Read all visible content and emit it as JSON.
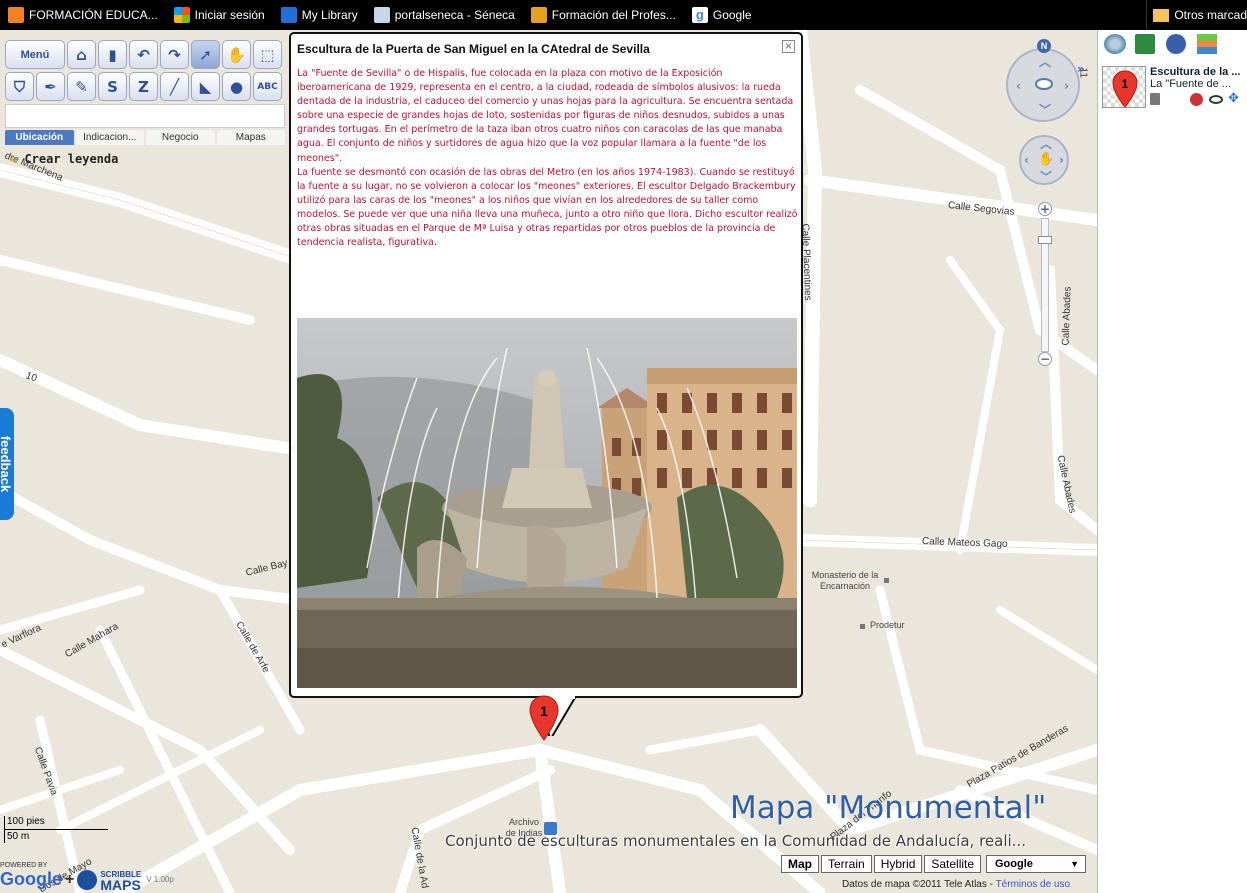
{
  "bookmarks": [
    {
      "label": "FORMACIÓN EDUCA...",
      "icon": "formacion-icon",
      "color": "#f58220"
    },
    {
      "label": "Iniciar sesión",
      "icon": "windows-icon",
      "color": "#2a8ad4"
    },
    {
      "label": "My Library",
      "icon": "library-icon",
      "color": "#1e6fd9"
    },
    {
      "label": "portalseneca - Séneca",
      "icon": "page-icon",
      "color": "#c9d6e8"
    },
    {
      "label": "Formación del Profes...",
      "icon": "formacion-profes-icon",
      "color": "#e8a020"
    },
    {
      "label": "Google",
      "icon": "google-icon",
      "color": "#4285f4"
    }
  ],
  "bookmarks_right": {
    "label": "Otros marcad",
    "icon": "folder-icon"
  },
  "toolbar": {
    "menu_label": "Menú",
    "tabs": [
      "Ubicación",
      "Indicacion...",
      "Negocio",
      "Mapas"
    ],
    "legend_label": "Crear leyenda"
  },
  "feedback_label": "feedback",
  "streets": [
    "dre Marchena",
    "Calle Placentines",
    "Calle Segovias",
    "Calle Abades",
    "Calle Abades",
    "Calle Mateos Gago",
    "Calle Bay",
    "e Varflora",
    "Calle Mahara",
    "Calle de Arfe",
    "Calle Pavia",
    "Calle de la Ad",
    "Plaza del Triunfo",
    "Plaza Patios de Banderas",
    "Dos de Mayo",
    "10",
    "11"
  ],
  "pois": {
    "monasterio": "Monasterio de la Encarnación",
    "prodetur": "Prodetur",
    "archivo": "Archivo de Indias"
  },
  "popup": {
    "title": "Escultura de la Puerta de San Miguel en la CAtedral de Sevilla",
    "close": "×",
    "paragraph1": "La \"Fuente de Sevilla\" o de Hispalis, fue colocada en la plaza con motivo de la Exposición iberoamericana de 1929, representa en el centro, a la ciudad, rodeada de símbolos alusivos: la rueda dentada de la industria, el caduceo del comercio y unas hojas para la agricultura. Se encuentra sentada sobre una especie de grandes hojas de loto, sostenidas por figuras de niños desnudos, subidos a unas grandes tortugas. En el perímetro de la taza iban otros cuatro niños con caracolas de las que manaba agua. El conjunto de niños y surtidores de agua hizo que la voz popular llamara a la fuente \"de los meones\".",
    "paragraph2": "La fuente se desmontó con ocasión de las obras del Metro (en los años 1974-1983). Cuando se restituyó la fuente a su lugar, no se volvieron a colocar los \"meones\" exteriores. El escultor Delgado Brackembury utilizó para las caras de los \"meones\" a los niños que vivían en los alrededores de su taller como modelos. Se puede ver que una niña lleva una muñeca, junto a otro niño que llora. Dicho escultor realizó otras obras situadas en el Parque de Mª Luisa y otras repartidas por otros pueblos de la provincia de tendencia realista, figurativa."
  },
  "marker_number": "1",
  "nav": {
    "north": "N",
    "zoom_in": "+",
    "zoom_out": "−"
  },
  "map_title": "Mapa \"Monumental\"",
  "map_subtitle": "Conjunto de esculturas monumentales en la Comunidad de Andalucía, reali...",
  "map_types": [
    "Map",
    "Terrain",
    "Hybrid",
    "Satellite"
  ],
  "map_type_selected": "Map",
  "provider": "Google",
  "copyright": {
    "text": "Datos de mapa ©2011 Tele Atlas - ",
    "link": "Términos de uso"
  },
  "scale": {
    "ft": "100 pies",
    "m": "50 m"
  },
  "powered": {
    "label": "POWERED BY",
    "google": "Google",
    "plus": "+",
    "scribble": "SCRIBBLE",
    "maps": "MAPS",
    "version": "V 1.00p"
  },
  "panel": {
    "layer_title": "Escultura de la ...",
    "layer_desc": "La \"Fuente de ...",
    "layer_marker": "1"
  },
  "colors": {
    "accent": "#4d79c2",
    "popup_text": "#c8102e",
    "map_bg": "#ebe6dc",
    "road": "#ffffff",
    "feedback": "#1a7bd6",
    "title": "#2f5fa8"
  }
}
